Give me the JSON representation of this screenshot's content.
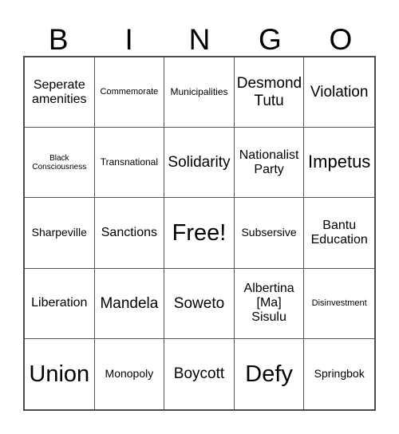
{
  "card": {
    "title_letters": [
      "B",
      "I",
      "N",
      "G",
      "O"
    ],
    "rows": [
      [
        {
          "text": "Seperate\namenities",
          "size": "fs-l"
        },
        {
          "text": "Commemorate",
          "size": "fs-s"
        },
        {
          "text": "Municipalities",
          "size": "fs-sm"
        },
        {
          "text": "Desmond\nTutu",
          "size": "fs-xl"
        },
        {
          "text": "Violation",
          "size": "fs-xl"
        }
      ],
      [
        {
          "text": "Black\nConsciousness",
          "size": "fs-xs"
        },
        {
          "text": "Transnational",
          "size": "fs-sm"
        },
        {
          "text": "Solidarity",
          "size": "fs-xl"
        },
        {
          "text": "Nationalist\nParty",
          "size": "fs-l"
        },
        {
          "text": "Impetus",
          "size": "fs-xxl"
        }
      ],
      [
        {
          "text": "Sharpeville",
          "size": "fs-m"
        },
        {
          "text": "Sanctions",
          "size": "fs-l"
        },
        {
          "text": "Free!",
          "size": "fs-huge"
        },
        {
          "text": "Subsersive",
          "size": "fs-m"
        },
        {
          "text": "Bantu\nEducation",
          "size": "fs-l"
        }
      ],
      [
        {
          "text": "Liberation",
          "size": "fs-l"
        },
        {
          "text": "Mandela",
          "size": "fs-xl"
        },
        {
          "text": "Soweto",
          "size": "fs-xl"
        },
        {
          "text": "Albertina\n[Ma]\nSisulu",
          "size": "fs-l"
        },
        {
          "text": "Disinvestment",
          "size": "fs-s"
        }
      ],
      [
        {
          "text": "Union",
          "size": "fs-huge"
        },
        {
          "text": "Monopoly",
          "size": "fs-m"
        },
        {
          "text": "Boycott",
          "size": "fs-xl"
        },
        {
          "text": "Defy",
          "size": "fs-huge"
        },
        {
          "text": "Springbok",
          "size": "fs-m"
        }
      ]
    ]
  },
  "colors": {
    "grid_border": "#4d4d4d",
    "cell_divider": "#555555",
    "text": "#000000",
    "background": "#ffffff"
  }
}
